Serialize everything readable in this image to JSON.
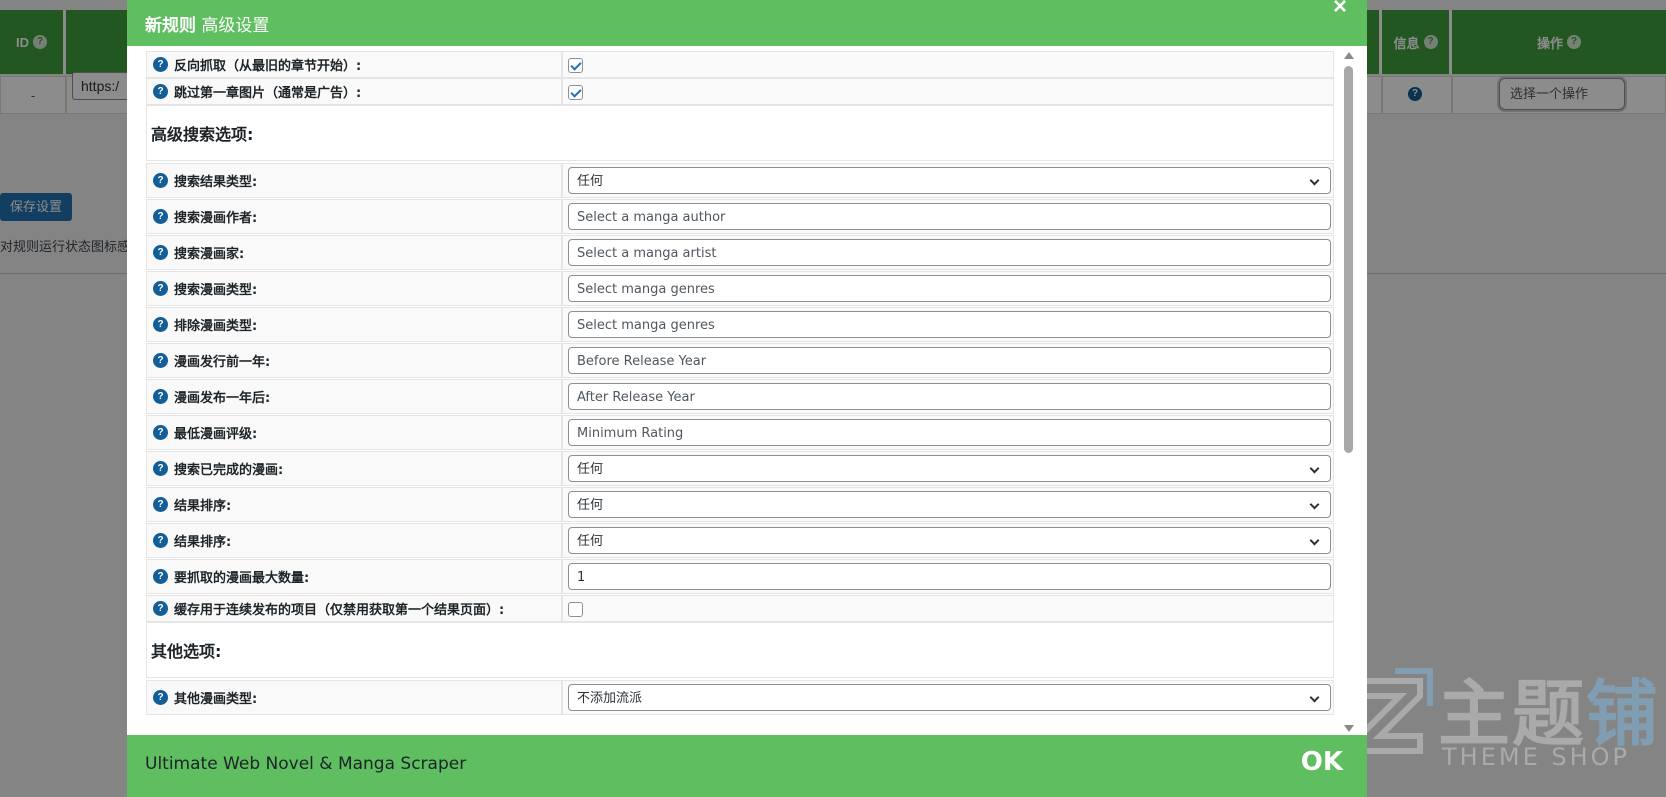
{
  "background": {
    "col_id": "ID",
    "col_info": "信息",
    "col_action": "操作",
    "help_mark": "?",
    "row_id": "-",
    "url_value": "https:/",
    "action_select": "选择一个操作",
    "save_button": "保存设置",
    "note_text": "对规则运行状态图标感"
  },
  "watermark": {
    "main": "主题",
    "main_accent": "铺",
    "sub": "THEME SHOP"
  },
  "modal": {
    "title_bold": "新规则",
    "title_rest": " 高级设置",
    "close_label": "×",
    "help_mark": "?",
    "rows": {
      "reverse": {
        "label": "反向抓取（从最旧的章节开始）:",
        "checked": true
      },
      "skip_first": {
        "label": "跳过第一章图片（通常是广告）:",
        "checked": true
      },
      "section_advanced": "高级搜索选项:",
      "result_type": {
        "label": "搜索结果类型:",
        "value": "任何"
      },
      "author": {
        "label": "搜索漫画作者:",
        "placeholder": "Select a manga author"
      },
      "artist": {
        "label": "搜索漫画家:",
        "placeholder": "Select a manga artist"
      },
      "genres": {
        "label": "搜索漫画类型:",
        "placeholder": "Select manga genres"
      },
      "exclude_genres": {
        "label": "排除漫画类型:",
        "placeholder": "Select manga genres"
      },
      "before_year": {
        "label": "漫画发行前一年:",
        "placeholder": "Before Release Year"
      },
      "after_year": {
        "label": "漫画发布一年后:",
        "placeholder": "After Release Year"
      },
      "min_rating": {
        "label": "最低漫画评级:",
        "placeholder": "Minimum Rating"
      },
      "completed": {
        "label": "搜索已完成的漫画:",
        "value": "任何"
      },
      "sort1": {
        "label": "结果排序:",
        "value": "任何"
      },
      "sort2": {
        "label": "结果排序:",
        "value": "任何"
      },
      "max_count": {
        "label": "要抓取的漫画最大数量:",
        "value": "1"
      },
      "cache": {
        "label": "缓存用于连续发布的项目（仅禁用获取第一个结果页面）:",
        "checked": false
      },
      "section_other": "其他选项:",
      "other_type": {
        "label": "其他漫画类型:",
        "value": "不添加流派"
      }
    },
    "footer_text": "Ultimate Web Novel & Manga Scraper",
    "ok_label": "OK"
  },
  "colors": {
    "header_green": "#5fbe5f",
    "table_green": "#3e9e3e",
    "help_blue": "#135e96"
  }
}
